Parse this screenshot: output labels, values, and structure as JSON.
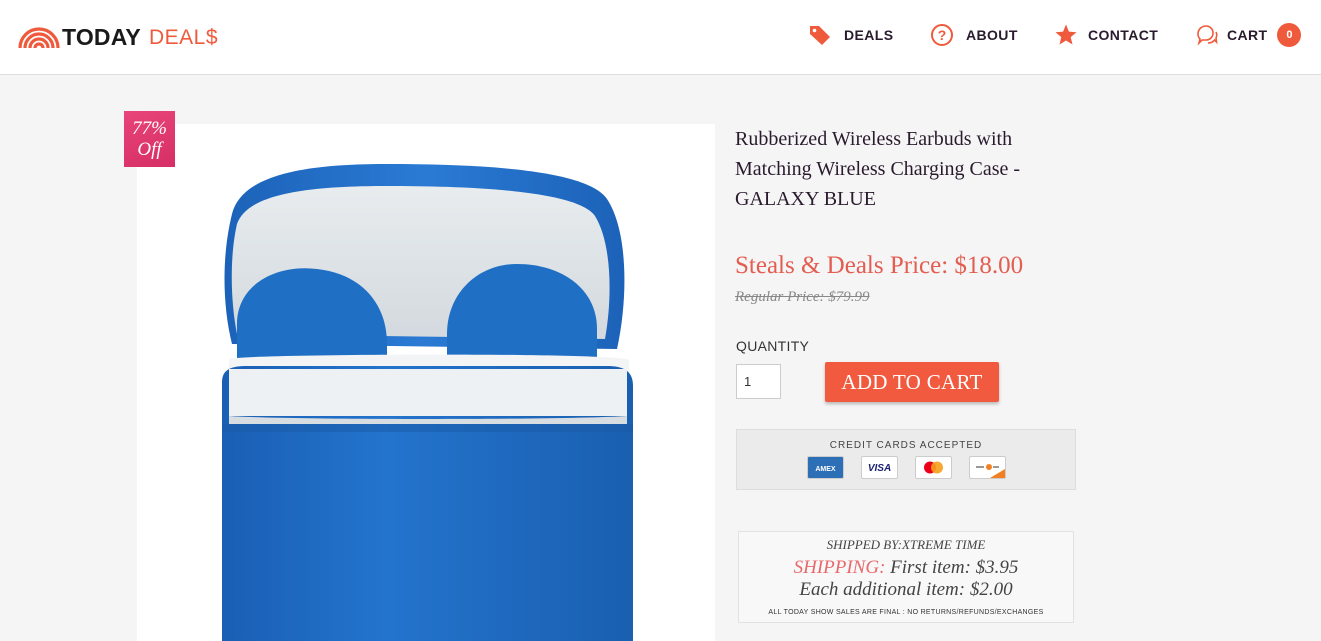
{
  "header": {
    "logo_today": "TODAY",
    "logo_deals": "DEAL$",
    "nav": [
      {
        "label": "DEALS",
        "icon": "tag-icon"
      },
      {
        "label": "ABOUT",
        "icon": "question-circle-icon"
      },
      {
        "label": "CONTACT",
        "icon": "star-icon"
      },
      {
        "label": "CART",
        "icon": "chat-bubbles-icon"
      }
    ],
    "cart_count": "0"
  },
  "product": {
    "discount_line1": "77%",
    "discount_line2": "Off",
    "title": "Rubberized Wireless Earbuds with Matching Wireless Charging Case - GALAXY BLUE",
    "price": "Steals & Deals Price: $18.00",
    "regular_price": "Regular Price: $79.99",
    "quantity_label": "QUANTITY",
    "quantity_value": "1",
    "add_to_cart": "ADD TO CART"
  },
  "payment": {
    "title": "CREDIT CARDS ACCEPTED",
    "cards": [
      "AMEX",
      "VISA",
      "mastercard",
      "discover"
    ]
  },
  "shipping": {
    "shipped_by": "SHIPPED BY:XTREME TIME",
    "shipping_word": "SHIPPING:",
    "first_item": "First item: $3.95",
    "additional": "Each additional item: $2.00",
    "final_note": "ALL TODAY SHOW SALES ARE FINAL : NO RETURNS/REFUNDS/EXCHANGES"
  },
  "colors": {
    "accent": "#f05a3c",
    "price": "#e35d51",
    "badge": "#d62e66",
    "product_blue": "#1f6fc4"
  }
}
